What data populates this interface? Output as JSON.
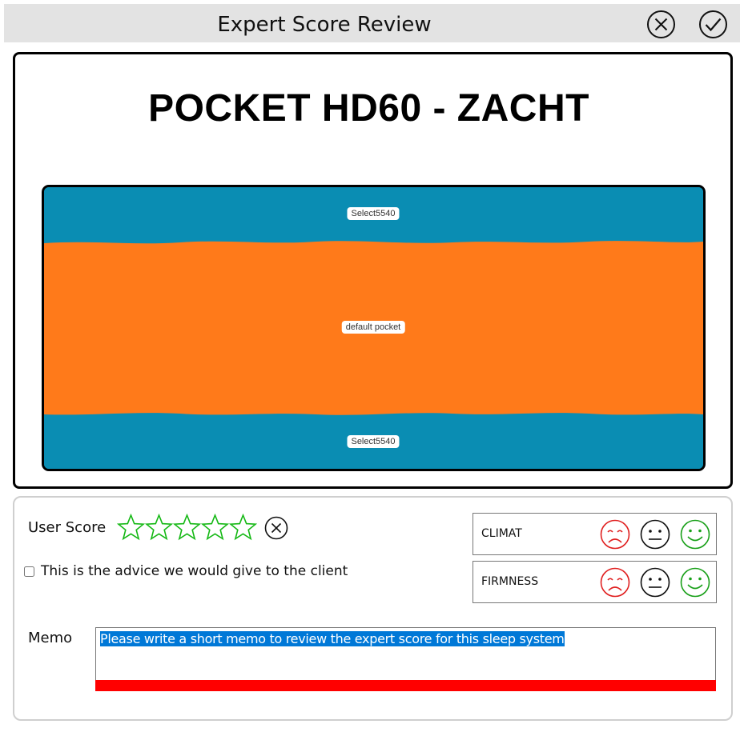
{
  "window": {
    "title": "Expert Score Review",
    "cancel_icon": "close-circle-icon",
    "confirm_icon": "check-circle-icon"
  },
  "product": {
    "name": "POCKET HD60 - ZACHT",
    "layers": [
      {
        "label": "Select5540",
        "color": "#0a8db3"
      },
      {
        "label": "default pocket",
        "color": "#ff7a1a"
      },
      {
        "label": "Select5540",
        "color": "#0a8db3"
      }
    ]
  },
  "review": {
    "user_score_label": "User Score",
    "stars_total": 5,
    "stars_filled": 0,
    "star_color": "#14b814",
    "clear_score_icon": "close-circle-icon",
    "advice_checkbox_label": "This is the advice we would give to the client",
    "advice_checked": false,
    "ratings": [
      {
        "label": "CLIMAT",
        "faces": [
          "sad-face-icon",
          "neutral-face-icon",
          "happy-face-icon"
        ]
      },
      {
        "label": "FIRMNESS",
        "faces": [
          "sad-face-icon",
          "neutral-face-icon",
          "happy-face-icon"
        ]
      }
    ],
    "face_colors": {
      "sad": "#e02020",
      "neutral": "#111111",
      "happy": "#1aa01a"
    },
    "memo_label": "Memo",
    "memo_value": "Please write a short memo to review the expert score for this sleep system",
    "memo_error_color": "#ff0000"
  }
}
